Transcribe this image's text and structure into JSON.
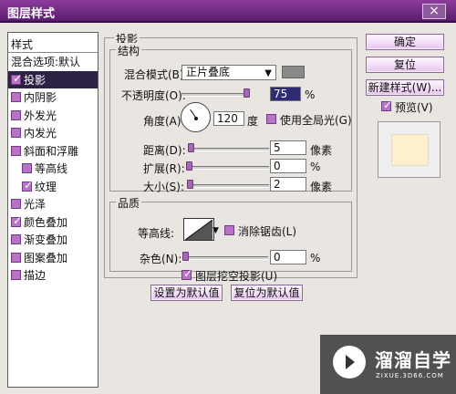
{
  "window": {
    "title": "图层样式",
    "close": "×"
  },
  "left_panel": {
    "header": "样式",
    "items": [
      {
        "label": "混合选项:默认",
        "checkbox": false,
        "checked": false,
        "selected": false
      },
      {
        "label": "投影",
        "checkbox": true,
        "checked": true,
        "selected": true
      },
      {
        "label": "内阴影",
        "checkbox": true,
        "checked": false,
        "selected": false
      },
      {
        "label": "外发光",
        "checkbox": true,
        "checked": false,
        "selected": false
      },
      {
        "label": "内发光",
        "checkbox": true,
        "checked": false,
        "selected": false
      },
      {
        "label": "斜面和浮雕",
        "checkbox": true,
        "checked": false,
        "selected": false
      },
      {
        "label": "等高线",
        "checkbox": true,
        "checked": false,
        "selected": false,
        "sub": true
      },
      {
        "label": "纹理",
        "checkbox": true,
        "checked": true,
        "selected": false,
        "sub": true
      },
      {
        "label": "光泽",
        "checkbox": true,
        "checked": false,
        "selected": false
      },
      {
        "label": "颜色叠加",
        "checkbox": true,
        "checked": true,
        "selected": false
      },
      {
        "label": "渐变叠加",
        "checkbox": true,
        "checked": false,
        "selected": false
      },
      {
        "label": "图案叠加",
        "checkbox": true,
        "checked": false,
        "selected": false
      },
      {
        "label": "描边",
        "checkbox": true,
        "checked": false,
        "selected": false
      }
    ]
  },
  "drop_shadow": {
    "title": "投影",
    "structure": {
      "title": "结构",
      "blend_mode_label": "混合模式(B):",
      "blend_mode_value": "正片叠底",
      "opacity_label": "不透明度(O):",
      "opacity_value": "75",
      "opacity_level": 0.75,
      "percent": "%",
      "angle_label": "角度(A):",
      "angle_value": "120",
      "degree": "度",
      "global_light_label": "使用全局光(G)",
      "distance_label": "距离(D):",
      "distance_value": "5",
      "size_unit": "像素",
      "spread_label": "扩展(R):",
      "spread_value": "0",
      "size_label": "大小(S):",
      "size_value": "2"
    },
    "quality": {
      "title": "品质",
      "contour_label": "等高线:",
      "anti_alias_label": "消除锯齿(L)",
      "noise_label": "杂色(N):",
      "noise_value": "0",
      "percent": "%"
    },
    "knockout_label": "图层挖空投影(U)",
    "make_default_label": "设置为默认值",
    "reset_default_label": "复位为默认值"
  },
  "right_buttons": {
    "ok": "确定",
    "reset": "复位",
    "new_style": "新建样式(W)...",
    "preview": "预览(V)"
  },
  "watermark": {
    "main": "溜溜自学",
    "sub": "ZIXUE.3D66.COM"
  },
  "colors": {
    "title_bar": "#6f2a82",
    "accent": "#b873c6",
    "preview_swatch": "#fff0cd"
  }
}
